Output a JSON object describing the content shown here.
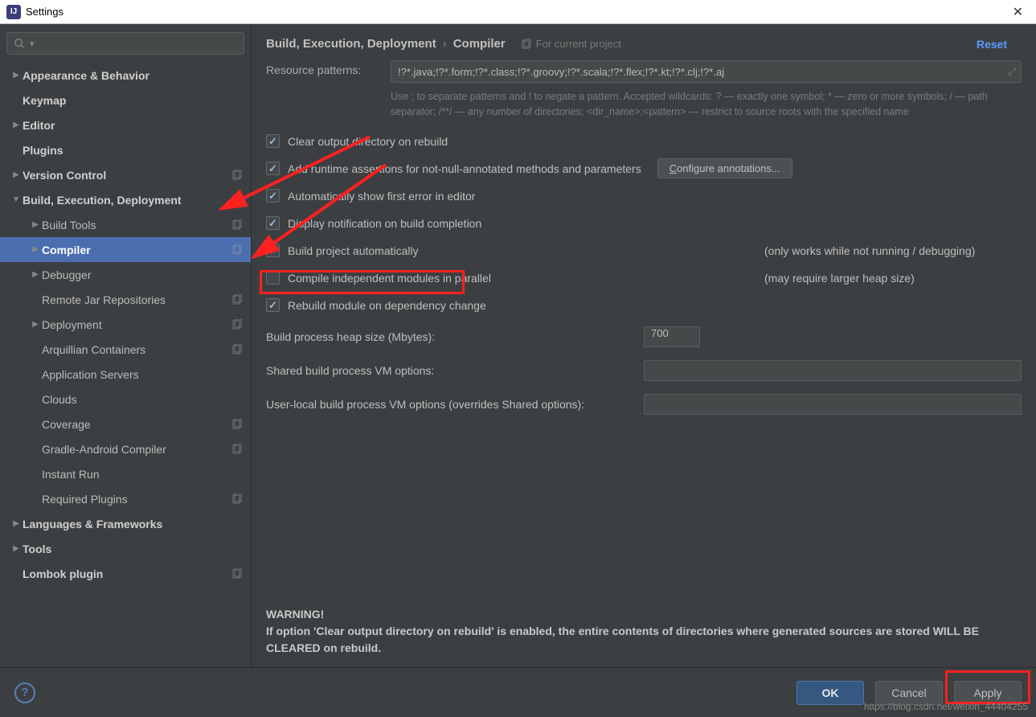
{
  "window": {
    "title": "Settings"
  },
  "search": {
    "placeholder": ""
  },
  "tree": [
    {
      "label": "Appearance & Behavior",
      "arrow": "right",
      "bold": true,
      "indent": 0
    },
    {
      "label": "Keymap",
      "arrow": "none",
      "bold": true,
      "indent": 0
    },
    {
      "label": "Editor",
      "arrow": "right",
      "bold": true,
      "indent": 0
    },
    {
      "label": "Plugins",
      "arrow": "none",
      "bold": true,
      "indent": 0
    },
    {
      "label": "Version Control",
      "arrow": "right",
      "bold": true,
      "indent": 0,
      "projIcon": true
    },
    {
      "label": "Build, Execution, Deployment",
      "arrow": "down",
      "bold": true,
      "indent": 0
    },
    {
      "label": "Build Tools",
      "arrow": "right",
      "indent": 1,
      "projIcon": true
    },
    {
      "label": "Compiler",
      "arrow": "right",
      "indent": 1,
      "projIcon": true,
      "selected": true
    },
    {
      "label": "Debugger",
      "arrow": "right",
      "indent": 1
    },
    {
      "label": "Remote Jar Repositories",
      "arrow": "none",
      "indent": 1,
      "projIcon": true
    },
    {
      "label": "Deployment",
      "arrow": "right",
      "indent": 1,
      "projIcon": true
    },
    {
      "label": "Arquillian Containers",
      "arrow": "none",
      "indent": 1,
      "projIcon": true
    },
    {
      "label": "Application Servers",
      "arrow": "none",
      "indent": 1
    },
    {
      "label": "Clouds",
      "arrow": "none",
      "indent": 1
    },
    {
      "label": "Coverage",
      "arrow": "none",
      "indent": 1,
      "projIcon": true
    },
    {
      "label": "Gradle-Android Compiler",
      "arrow": "none",
      "indent": 1,
      "projIcon": true
    },
    {
      "label": "Instant Run",
      "arrow": "none",
      "indent": 1
    },
    {
      "label": "Required Plugins",
      "arrow": "none",
      "indent": 1,
      "projIcon": true
    },
    {
      "label": "Languages & Frameworks",
      "arrow": "right",
      "bold": true,
      "indent": 0
    },
    {
      "label": "Tools",
      "arrow": "right",
      "bold": true,
      "indent": 0
    },
    {
      "label": "Lombok plugin",
      "arrow": "none",
      "bold": true,
      "indent": 0,
      "projIcon": true
    }
  ],
  "breadcrumb": {
    "seg1": "Build, Execution, Deployment",
    "sep": "›",
    "seg2": "Compiler"
  },
  "contextHint": "For current project",
  "resetLabel": "Reset",
  "resourcePatterns": {
    "label": "Resource patterns:",
    "value": "!?*.java;!?*.form;!?*.class;!?*.groovy;!?*.scala;!?*.flex;!?*.kt;!?*.clj;!?*.aj"
  },
  "patternHint": "Use ; to separate patterns and ! to negate a pattern. Accepted wildcards: ? — exactly one symbol; * — zero or more symbols; / — path separator; /**/ — any number of directories; <dir_name>:<pattern> — restrict to source roots with the specified name",
  "checkboxes": {
    "clearOutput": {
      "label": "Clear output directory on rebuild",
      "checked": true
    },
    "addAssertions": {
      "label": "Add runtime assertions for not-null-annotated methods and parameters",
      "checked": true,
      "button": "Configure annotations..."
    },
    "autoShowError": {
      "label": "Automatically show first error in editor",
      "checked": true
    },
    "displayNotif": {
      "label": "Display notification on build completion",
      "checked": true
    },
    "buildAuto": {
      "label": "Build project automatically",
      "checked": true,
      "note": "(only works while not running / debugging)"
    },
    "compileParallel": {
      "label": "Compile independent modules in parallel",
      "checked": false,
      "note": "(may require larger heap size)"
    },
    "rebuildDep": {
      "label": "Rebuild module on dependency change",
      "checked": true
    }
  },
  "options": {
    "heapSize": {
      "label": "Build process heap size (Mbytes):",
      "value": "700"
    },
    "sharedVM": {
      "label": "Shared build process VM options:",
      "value": ""
    },
    "userVM": {
      "label": "User-local build process VM options (overrides Shared options):",
      "value": ""
    }
  },
  "warning": {
    "title": "WARNING!",
    "text": "If option 'Clear output directory on rebuild' is enabled, the entire contents of directories where generated sources are stored WILL BE CLEARED on rebuild."
  },
  "footer": {
    "ok": "OK",
    "cancel": "Cancel",
    "apply": "Apply"
  },
  "watermark": "https://blog.csdn.net/weixin_44404255"
}
